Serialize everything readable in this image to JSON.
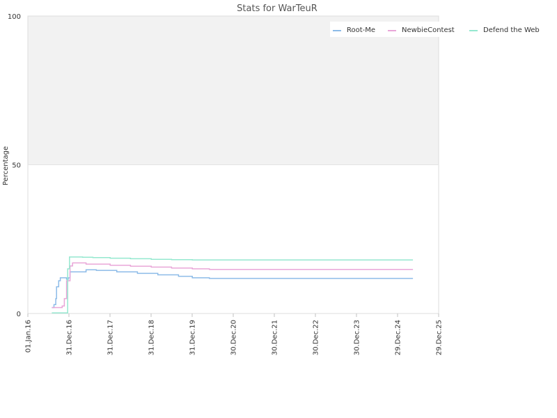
{
  "chart_data": {
    "type": "line",
    "title": "Stats for WarTeuR",
    "ylabel": "Percentage",
    "xlabel": "",
    "ylim": [
      0,
      100
    ],
    "yticks": [
      "0",
      "50",
      "100"
    ],
    "xlim": [
      "2016-01-01",
      "2025-12-29"
    ],
    "xticks": [
      {
        "label": "01.Jan.16",
        "date": "2016-01-01"
      },
      {
        "label": "31.Dec.16",
        "date": "2016-12-31"
      },
      {
        "label": "31.Dec.17",
        "date": "2017-12-31"
      },
      {
        "label": "31.Dec.18",
        "date": "2018-12-31"
      },
      {
        "label": "31.Dec.19",
        "date": "2019-12-31"
      },
      {
        "label": "30.Dec.20",
        "date": "2020-12-30"
      },
      {
        "label": "30.Dec.21",
        "date": "2021-12-30"
      },
      {
        "label": "30.Dec.22",
        "date": "2022-12-30"
      },
      {
        "label": "30.Dec.23",
        "date": "2023-12-30"
      },
      {
        "label": "29.Dec.24",
        "date": "2024-12-29"
      },
      {
        "label": "29.Dec.25",
        "date": "2025-12-29"
      }
    ],
    "band": {
      "from": 50,
      "to": 100,
      "color": "#f2f2f2"
    },
    "legend_position": "top-right",
    "series": [
      {
        "name": "Root-Me",
        "color": "#8cbbe8",
        "points": [
          [
            "2016-08-01",
            2
          ],
          [
            "2016-08-20",
            3
          ],
          [
            "2016-09-05",
            5
          ],
          [
            "2016-09-12",
            9
          ],
          [
            "2016-10-01",
            11
          ],
          [
            "2016-10-15",
            12
          ],
          [
            "2016-11-10",
            12
          ],
          [
            "2016-12-10",
            11.5
          ],
          [
            "2016-12-25",
            12
          ],
          [
            "2017-01-10",
            14
          ],
          [
            "2017-05-01",
            14
          ],
          [
            "2017-06-01",
            14.7
          ],
          [
            "2017-09-01",
            14.5
          ],
          [
            "2018-03-01",
            14
          ],
          [
            "2018-09-01",
            13.5
          ],
          [
            "2019-03-01",
            13
          ],
          [
            "2019-09-01",
            12.5
          ],
          [
            "2020-01-01",
            12
          ],
          [
            "2020-06-01",
            11.8
          ],
          [
            "2024-12-01",
            11.8
          ],
          [
            "2025-05-15",
            11.8
          ]
        ]
      },
      {
        "name": "NewbieContest",
        "color": "#e9a6d8",
        "points": [
          [
            "2016-08-01",
            2
          ],
          [
            "2016-10-15",
            2
          ],
          [
            "2016-11-01",
            2.5
          ],
          [
            "2016-11-20",
            5
          ],
          [
            "2016-12-10",
            11
          ],
          [
            "2017-01-10",
            16
          ],
          [
            "2017-02-01",
            17
          ],
          [
            "2017-06-01",
            16.6
          ],
          [
            "2018-01-01",
            16.2
          ],
          [
            "2018-07-01",
            15.9
          ],
          [
            "2019-01-01",
            15.6
          ],
          [
            "2019-07-01",
            15.3
          ],
          [
            "2020-01-01",
            15
          ],
          [
            "2020-06-01",
            14.8
          ],
          [
            "2024-12-01",
            14.8
          ],
          [
            "2025-05-15",
            14.8
          ]
        ]
      },
      {
        "name": "Defend the Web",
        "color": "#94e8cf",
        "points": [
          [
            "2016-08-01",
            0.2
          ],
          [
            "2016-11-25",
            0.2
          ],
          [
            "2016-12-20",
            15
          ],
          [
            "2017-01-05",
            19
          ],
          [
            "2017-05-01",
            18.9
          ],
          [
            "2017-08-01",
            18.8
          ],
          [
            "2018-01-01",
            18.6
          ],
          [
            "2018-07-01",
            18.4
          ],
          [
            "2019-01-01",
            18.2
          ],
          [
            "2019-07-01",
            18.1
          ],
          [
            "2020-01-01",
            18
          ],
          [
            "2024-12-01",
            18
          ],
          [
            "2025-05-15",
            18
          ]
        ]
      }
    ]
  }
}
